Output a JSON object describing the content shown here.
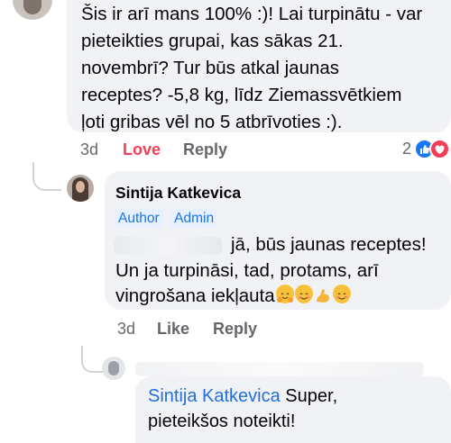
{
  "comment1": {
    "lines": [
      "Šis ir arī mans 100% :)! Lai turpinātu - var",
      "pieteikties grupai, kas sākas 21.",
      "novembrī? Tur būs atkal jaunas",
      "receptes? -5,8 kg, līdz Ziemassvētkiem",
      "ļoti gribas vēl no 5 atbrīvoties :)."
    ],
    "time": "3d",
    "love_label": "Love",
    "reply_label": "Reply",
    "reaction_count": "2",
    "reaction_icons": [
      "like-icon",
      "love-icon"
    ],
    "love_color": "#f33e58"
  },
  "reply1": {
    "author": "Sintija Katkevica",
    "badges": [
      "Author",
      "Admin"
    ],
    "line1": "jā, būs jaunas receptes!",
    "line2": "Un ja turpināsi, tad, protams, arī",
    "line3": "vingrošana iekļauta",
    "emojis": [
      "hug-emoji",
      "smile-emoji",
      "flexed-biceps-emoji",
      "smile-emoji"
    ],
    "time": "3d",
    "like_label": "Like",
    "reply_label": "Reply"
  },
  "reply2": {
    "mention": "Sintija Katkevica",
    "text_line1": " Super,",
    "text_line2": "pieteikšos noteikti!"
  },
  "colors": {
    "bubble": "#f0f2f5",
    "action_text": "#65676b",
    "link": "#216fdb",
    "like_blue": "#1877f2"
  }
}
